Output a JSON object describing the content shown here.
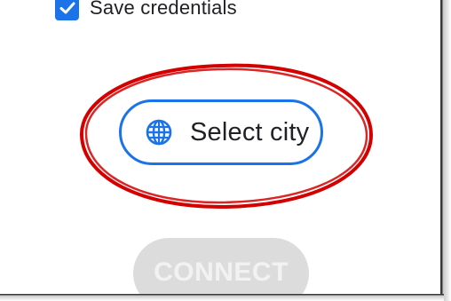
{
  "credentials": {
    "label": "Save credentials",
    "checked": true
  },
  "city_button": {
    "label": "Select city",
    "icon": "globe-icon"
  },
  "connect_button": {
    "label": "CONNECT",
    "enabled": false
  },
  "colors": {
    "accent": "#1a73e8",
    "annotation": "#d40000",
    "disabled": "#dcdcdc"
  }
}
